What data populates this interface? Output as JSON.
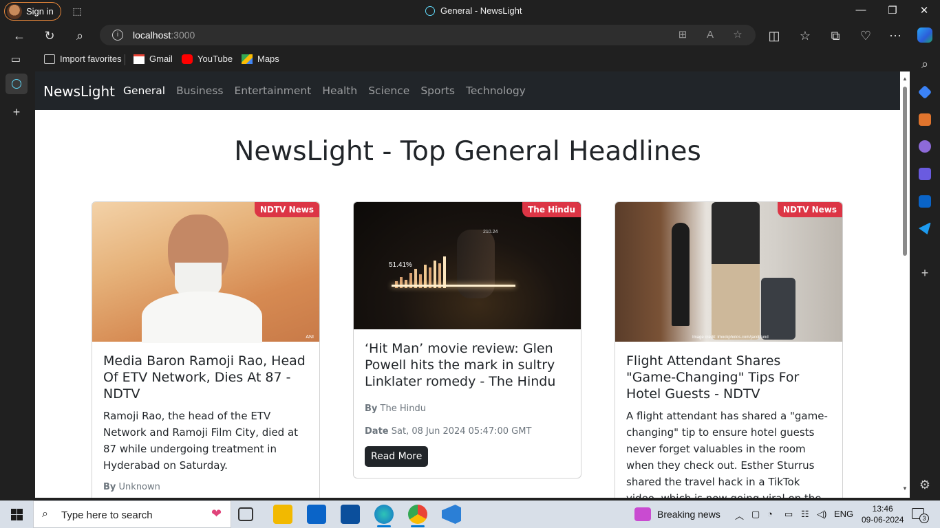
{
  "browser": {
    "signin_label": "Sign in",
    "window_title": "General - NewsLight",
    "url_host": "localhost",
    "url_port": ":3000",
    "favorites": [
      {
        "label": "Import favorites",
        "icon": "import-icon"
      },
      {
        "label": "Gmail",
        "icon": "gmail-icon"
      },
      {
        "label": "YouTube",
        "icon": "youtube-icon"
      },
      {
        "label": "Maps",
        "icon": "maps-icon"
      }
    ]
  },
  "app": {
    "brand": "NewsLight",
    "nav": [
      "General",
      "Business",
      "Entertainment",
      "Health",
      "Science",
      "Sports",
      "Technology"
    ],
    "active_nav": "General",
    "heading": "NewsLight - Top General Headlines",
    "labels": {
      "by": "By",
      "date": "Date",
      "read_more": "Read More"
    },
    "cards": [
      {
        "source": "NDTV News",
        "title": "Media Baron Ramoji Rao, Head Of ETV Network, Dies At 87 - NDTV",
        "description": "Ramoji Rao, the head of the ETV Network and Ramoji Film City, died at 87 while undergoing treatment in Hyderabad on Saturday.",
        "author": "Unknown",
        "image_caption": "ANI"
      },
      {
        "source": "The Hindu",
        "title": "‘Hit Man’ movie review: Glen Powell hits the mark in sultry Linklater romedy - The Hindu",
        "author": "The Hindu",
        "date": "Sat, 08 Jun 2024 05:47:00 GMT",
        "chart_labels": [
          "51.41%",
          "210.24"
        ]
      },
      {
        "source": "NDTV News",
        "title": "Flight Attendant Shares \"Game-Changing\" Tips For Hotel Guests - NDTV",
        "description": "A flight attendant has shared a \"game-changing\" tip to ensure hotel guests never forget valuables in the room when they check out. Esther Sturrus shared the travel hack in a TikTok video, which is now going viral on the social media platform.",
        "image_caption": "Image credit: Imockphotos.com/jacoblund"
      }
    ]
  },
  "taskbar": {
    "search_placeholder": "Type here to search",
    "news_label": "Breaking news",
    "lang": "ENG",
    "time": "13:46",
    "date": "09-06-2024",
    "notif_count": "3"
  },
  "colors": {
    "navbar": "#212529",
    "badge": "#dc3545",
    "accent": "#0078d4"
  }
}
